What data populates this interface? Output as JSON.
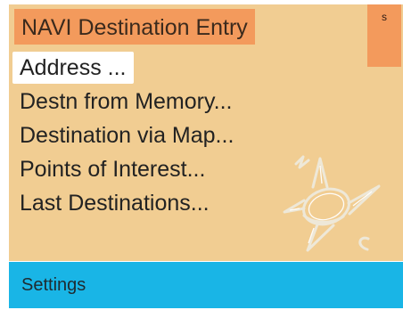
{
  "title": "NAVI Destination Entry",
  "status_indicator": "s",
  "menu": {
    "items": [
      {
        "label": "Address ...",
        "selected": true
      },
      {
        "label": "Destn from Memory..."
      },
      {
        "label": "Destination via Map..."
      },
      {
        "label": "Points of Interest..."
      },
      {
        "label": "Last Destinations..."
      }
    ]
  },
  "compass_icon": {
    "name": "compass-watermark-icon"
  },
  "footer": {
    "settings_label": "Settings"
  },
  "colors": {
    "panel_background": "#f1cd92",
    "title_background": "#f39a5c",
    "footer_background": "#19b5e6",
    "selected_background": "#ffffff",
    "text": "#222222"
  }
}
